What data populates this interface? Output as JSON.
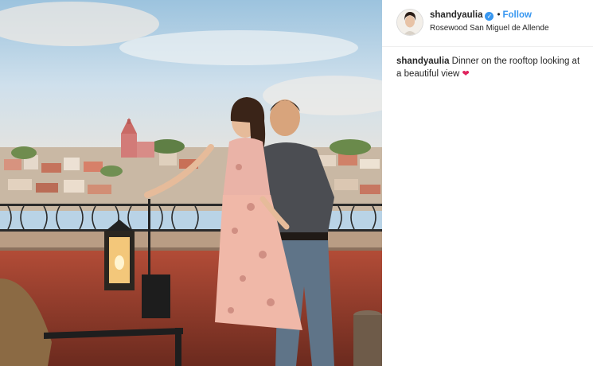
{
  "post": {
    "username": "shandyaulia",
    "verified_icon": "verified-badge-icon",
    "separator": "•",
    "follow_label": "Follow",
    "location": "Rosewood San Miguel de Allende",
    "caption_user": "shandyaulia",
    "caption_text": "Dinner on the rooftop looking at a beautiful view",
    "caption_emoji": "❤"
  },
  "colors": {
    "link_blue": "#3897f0",
    "text": "#262626",
    "heart": "#e0245e"
  }
}
